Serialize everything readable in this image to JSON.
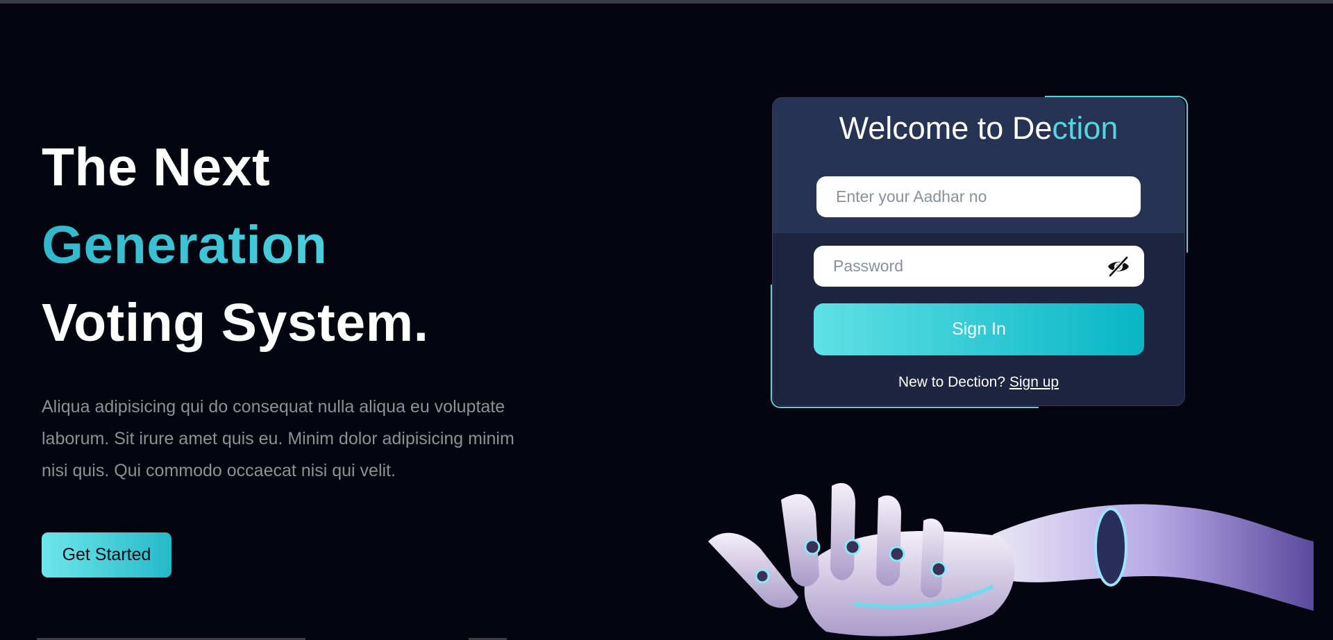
{
  "hero": {
    "title_line1": "The Next",
    "title_line2": "Generation",
    "title_line3": "Voting System.",
    "description": "Aliqua adipisicing qui do consequat nulla aliqua eu voluptate laborum. Sit irure amet quis eu. Minim dolor adipisicing minim nisi quis. Qui commodo occaecat nisi qui velit.",
    "cta_label": "Get Started"
  },
  "login": {
    "title_prefix": "Welcome to De",
    "title_accent": "ction",
    "aadhar_placeholder": "Enter your Aadhar no",
    "password_placeholder": "Password",
    "password_toggle_icon": "eye-slash-icon",
    "signin_label": "Sign In",
    "signup_prompt": "New to Dection? ",
    "signup_link": "Sign up"
  },
  "colors": {
    "background": "#04050f",
    "accent": "#56d4df",
    "card_top": "#273352",
    "card_bottom": "#1d2540"
  },
  "decor": {
    "hero_image": "robot-hand-illustration"
  }
}
